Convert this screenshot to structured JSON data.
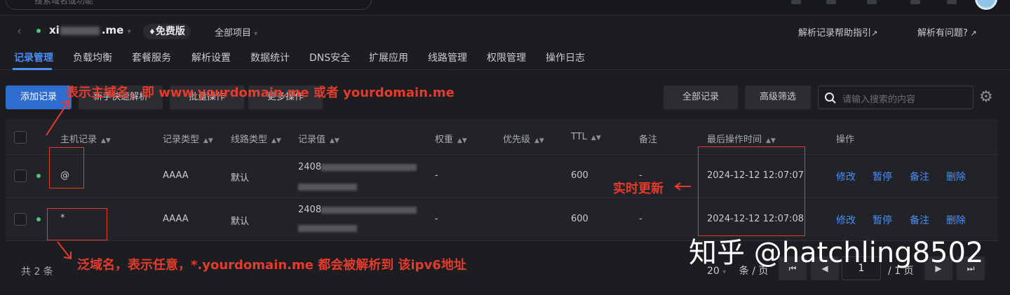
{
  "top": {
    "search_placeholder": "搜索域名或功能"
  },
  "domain": {
    "name_prefix": "xi",
    "name_suffix": ".me",
    "plan_badge": "免费版",
    "project": "全部项目"
  },
  "help": {
    "guide": "解析记录帮助指引",
    "issue": "解析有问题?"
  },
  "tabs": [
    "记录管理",
    "负载均衡",
    "套餐服务",
    "解析设置",
    "数据统计",
    "DNS安全",
    "扩展应用",
    "线路管理",
    "权限管理",
    "操作日志"
  ],
  "toolbar": {
    "add": "添加记录",
    "quick": "新手快速解析",
    "batch": "批量操作",
    "more": "更多操作",
    "all_records": "全部记录",
    "advanced": "高级筛选",
    "search_placeholder": "请输入搜索的内容"
  },
  "table": {
    "headers": {
      "host": "主机记录",
      "type": "记录类型",
      "line": "线路类型",
      "value": "记录值",
      "weight": "权重",
      "priority": "优先级",
      "ttl": "TTL",
      "remark": "备注",
      "updated": "最后操作时间",
      "ops": "操作"
    },
    "rows": [
      {
        "host": "@",
        "type": "AAAA",
        "line": "默认",
        "value": "2408",
        "weight": "-",
        "ttl": "600",
        "remark": "-",
        "updated": "2024-12-12 12:07:07"
      },
      {
        "host": "*",
        "type": "AAAA",
        "line": "默认",
        "value": "2408",
        "weight": "-",
        "ttl": "600",
        "remark": "-",
        "updated": "2024-12-12 12:07:08"
      }
    ],
    "actions": {
      "edit": "修改",
      "pause": "暂停",
      "note": "备注",
      "delete": "删除"
    }
  },
  "pagination": {
    "total": "共 2 条",
    "page_size": "20",
    "per_page_label": "条 / 页",
    "current_page": "1",
    "total_pages": "/ 1 页"
  },
  "annotations": {
    "main_domain": "表示主域名，即 www.yourdomain.me 或者 yourdomain.me",
    "realtime": "实时更新",
    "wildcard": "泛域名，表示任意，*.yourdomain.me 都会被解析到 该ipv6地址"
  },
  "watermark": "知乎 @hatchling8502",
  "colors": {
    "accent": "#4d8ef7",
    "primary_button": "#2f6ccf",
    "annotation": "#e53b2d",
    "status_ok": "#52c473"
  }
}
